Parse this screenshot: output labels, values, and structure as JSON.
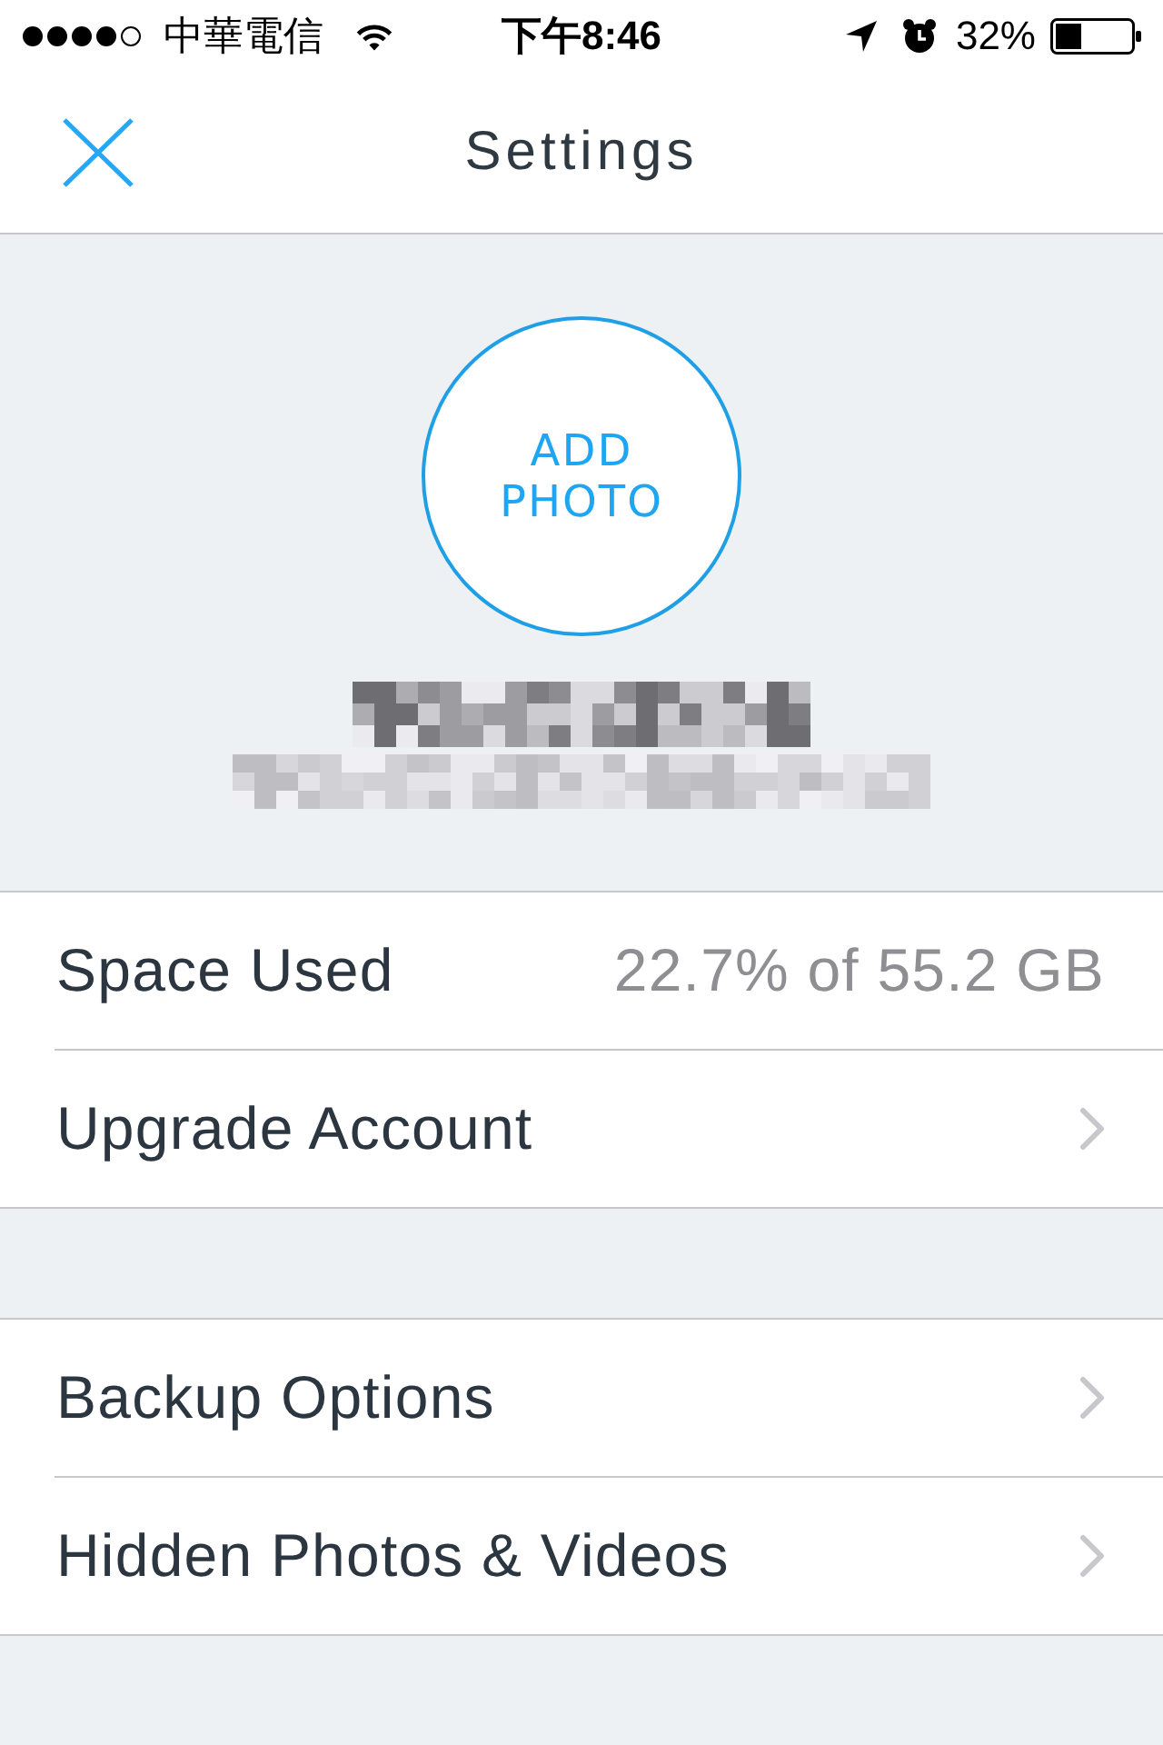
{
  "status_bar": {
    "carrier": "中華電信",
    "time": "下午8:46",
    "battery": "32%"
  },
  "nav_bar": {
    "title": "Settings"
  },
  "profile": {
    "add_photo": "ADD PHOTO"
  },
  "sections": [
    {
      "rows": [
        {
          "kind": "value",
          "label": "Space Used",
          "value": "22.7% of 55.2 GB"
        },
        {
          "kind": "link",
          "label": "Upgrade Account"
        }
      ]
    },
    {
      "rows": [
        {
          "kind": "link",
          "label": "Backup Options"
        },
        {
          "kind": "link",
          "label": "Hidden Photos & Videos"
        }
      ]
    }
  ]
}
